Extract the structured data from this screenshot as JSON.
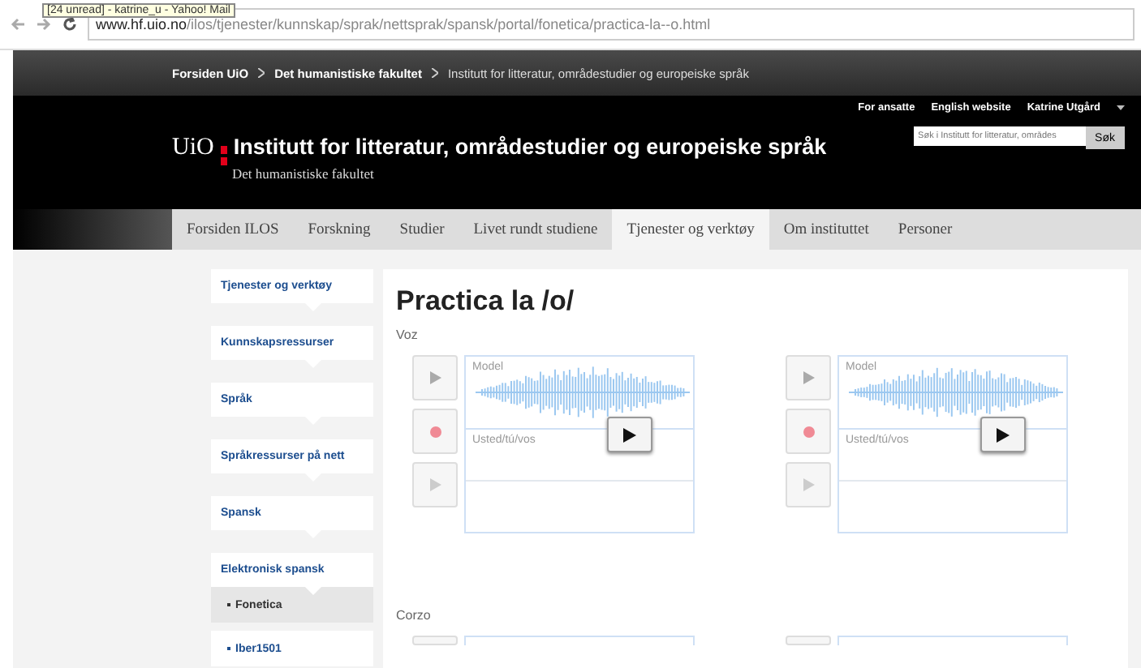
{
  "browser": {
    "tooltip": "[24 unread] - katrine_u - Yahoo! Mail",
    "url_host": "www.hf.uio.no",
    "url_path": "/ilos/tjenester/kunnskap/sprak/nettsprak/spansk/portal/fonetica/practica-la--o.html"
  },
  "breadcrumbs": [
    {
      "label": "Forsiden UiO",
      "kind": "link"
    },
    {
      "label": "Det humanistiske fakultet",
      "kind": "link"
    },
    {
      "label": "Institutt for litteratur, områdestudier og europeiske språk",
      "kind": "current"
    }
  ],
  "header": {
    "logo": "UiO",
    "title": "Institutt for litteratur, områdestudier og europeiske språk",
    "subtitle": "Det humanistiske fakultet",
    "links": [
      "For ansatte",
      "English website",
      "Katrine Utgård"
    ],
    "search": {
      "placeholder": "Søk i Institutt for litteratur, områdes",
      "button": "Søk"
    }
  },
  "tabs": [
    {
      "label": "Forsiden ILOS",
      "selected": false
    },
    {
      "label": "Forskning",
      "selected": false
    },
    {
      "label": "Studier",
      "selected": false
    },
    {
      "label": "Livet rundt studiene",
      "selected": false
    },
    {
      "label": "Tjenester og verktøy",
      "selected": true
    },
    {
      "label": "Om instituttet",
      "selected": false
    },
    {
      "label": "Personer",
      "selected": false
    }
  ],
  "sidebar": {
    "items": [
      {
        "label": "Tjenester og verktøy",
        "kind": "section",
        "selected": false
      },
      {
        "label": "Kunnskapsressurser",
        "kind": "section",
        "selected": false
      },
      {
        "label": "Språk",
        "kind": "section",
        "selected": false
      },
      {
        "label": "Språkressurser på nett",
        "kind": "section",
        "selected": false
      },
      {
        "label": "Spansk",
        "kind": "section",
        "selected": false
      },
      {
        "label": "Elektronisk spansk",
        "kind": "section",
        "selected": false
      },
      {
        "label": "Fonetica",
        "kind": "sub",
        "selected": true
      },
      {
        "label": "Iber1501",
        "kind": "sub",
        "selected": false
      }
    ]
  },
  "main": {
    "title": "Practica la /o/",
    "sections": [
      {
        "label": "Voz",
        "players": [
          {
            "model_label": "Model",
            "record_label": "Usted/tú/vos"
          },
          {
            "model_label": "Model",
            "record_label": "Usted/tú/vos"
          }
        ]
      },
      {
        "label": "Corzo",
        "players": [
          {
            "kind": "cut"
          },
          {
            "kind": "cut"
          }
        ]
      }
    ]
  }
}
